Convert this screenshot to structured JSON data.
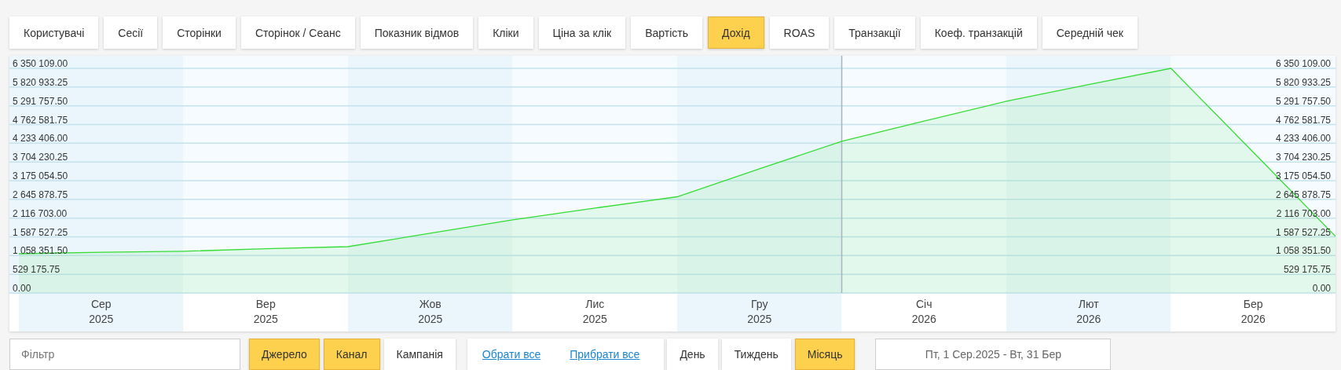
{
  "metric_tabs": [
    {
      "label": "Користувачі",
      "selected": false
    },
    {
      "label": "Сесії",
      "selected": false
    },
    {
      "label": "Сторінки",
      "selected": false
    },
    {
      "label": "Сторінок / Сеанс",
      "selected": false
    },
    {
      "label": "Показник відмов",
      "selected": false
    },
    {
      "label": "Кліки",
      "selected": false
    },
    {
      "label": "Ціна за клік",
      "selected": false
    },
    {
      "label": "Вартість",
      "selected": false
    },
    {
      "label": "Дохід",
      "selected": true
    },
    {
      "label": "ROAS",
      "selected": false
    },
    {
      "label": "Транзакції",
      "selected": false
    },
    {
      "label": "Коеф. транзакцій",
      "selected": false
    },
    {
      "label": "Середній чек",
      "selected": false
    }
  ],
  "chart": {
    "chart_data": {
      "type": "area",
      "categories": [
        null,
        "Сер 2025",
        null,
        "Вер 2025",
        null,
        "Жов 2025",
        null,
        "Лис 2025",
        null,
        "Гру 2025",
        null,
        "Січ 2026",
        null,
        "Лют 2026",
        null,
        "Бер 2026",
        null
      ],
      "series": [
        {
          "color": "#33dd33",
          "values": [
            1110000,
            1150000,
            1180000,
            1250000,
            1310000,
            1690000,
            2070000,
            2400000,
            2720000,
            3510000,
            4290000,
            4860000,
            5420000,
            5890000,
            6350000,
            3980000,
            1600000
          ]
        }
      ],
      "ylim": [
        0,
        6350109
      ],
      "grid": true,
      "yticks": [
        {
          "value": 0,
          "label": "0.00"
        },
        {
          "value": 529175.75,
          "label": "529 175.75"
        },
        {
          "value": 1058351.5,
          "label": "1 058 351.50"
        },
        {
          "value": 1587527.25,
          "label": "1 587 527.25"
        },
        {
          "value": 2116703,
          "label": "2 116 703.00"
        },
        {
          "value": 2645878.75,
          "label": "2 645 878.75"
        },
        {
          "value": 3175054.5,
          "label": "3 175 054.50"
        },
        {
          "value": 3704230.25,
          "label": "3 704 230.25"
        },
        {
          "value": 4233406,
          "label": "4 233 406.00"
        },
        {
          "value": 4762581.75,
          "label": "4 762 581.75"
        },
        {
          "value": 5291757.5,
          "label": "5 291 757.50"
        },
        {
          "value": 5820933.25,
          "label": "5 820 933.25"
        },
        {
          "value": 6350109,
          "label": "6 350 109.00"
        }
      ]
    }
  },
  "filter": {
    "placeholder": "Фільтр"
  },
  "group_by": [
    {
      "label": "Джерело",
      "selected": true
    },
    {
      "label": "Канал",
      "selected": true
    },
    {
      "label": "Кампанія",
      "selected": false
    }
  ],
  "links": [
    "Обрати все",
    "Прибрати все"
  ],
  "periods": [
    {
      "label": "День",
      "selected": false
    },
    {
      "label": "Тиждень",
      "selected": false
    },
    {
      "label": "Місяць",
      "selected": true
    }
  ],
  "date_range": {
    "value": "Пт, 1 Сер.2025 - Вт, 31 Бер"
  }
}
